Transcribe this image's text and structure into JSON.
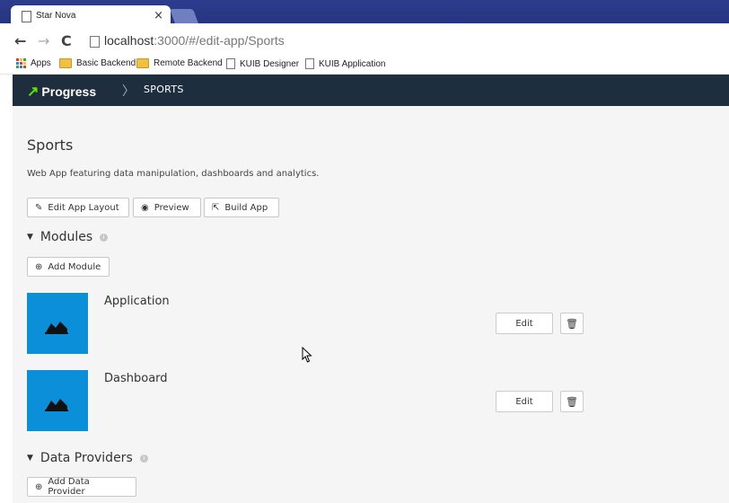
{
  "browser": {
    "tab_title": "Star Nova",
    "tab_close": "×",
    "url_host": "localhost",
    "url_path": ":3000/#/edit-app/Sports",
    "bookmarks": [
      {
        "label": "Apps",
        "icon": "apps-grid-icon"
      },
      {
        "label": "Basic Backend",
        "icon": "folder-icon"
      },
      {
        "label": "Remote Backend",
        "icon": "folder-icon"
      },
      {
        "label": "KUIB Designer",
        "icon": "page-icon"
      },
      {
        "label": "KUIB Application",
        "icon": "page-icon"
      }
    ]
  },
  "header": {
    "logo_text": "Progress",
    "breadcrumb": "SPORTS",
    "background": "#1f2e3f",
    "logo_accent": "#5ce500"
  },
  "app": {
    "title": "Sports",
    "description": "Web App featuring data manipulation, dashboards and analytics.",
    "actions": {
      "edit_layout": "Edit App Layout",
      "preview": "Preview",
      "build": "Build App"
    }
  },
  "modules": {
    "heading": "Modules",
    "add_label": "Add Module",
    "tile_color": "#0a8fd8",
    "items": [
      {
        "name": "Application",
        "edit_label": "Edit"
      },
      {
        "name": "Dashboard",
        "edit_label": "Edit"
      }
    ]
  },
  "data_providers": {
    "heading": "Data Providers",
    "add_label": "Add Data Provider"
  }
}
